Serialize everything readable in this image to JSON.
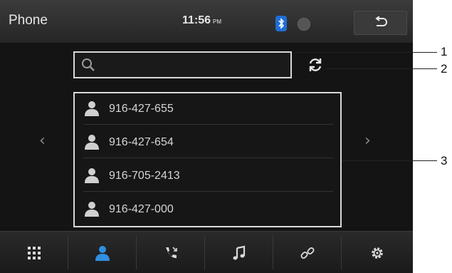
{
  "header": {
    "title": "Phone",
    "time": "11:56",
    "ampm": "PM",
    "bluetooth_icon": "bluetooth-icon",
    "status_icon": "status-circle-icon",
    "back_icon": "back-arrow-icon"
  },
  "search": {
    "placeholder": "",
    "value": "",
    "search_icon": "search-icon",
    "sync_icon": "sync-icon"
  },
  "contacts": [
    {
      "number": "916-427-655"
    },
    {
      "number": "916-427-654"
    },
    {
      "number": "916-705-2413"
    },
    {
      "number": "916-427-000"
    }
  ],
  "pager": {
    "prev": "‹",
    "next": "›"
  },
  "bottom_nav": [
    {
      "icon": "keypad-icon",
      "active": false
    },
    {
      "icon": "contacts-icon",
      "active": true
    },
    {
      "icon": "call-log-icon",
      "active": false
    },
    {
      "icon": "music-icon",
      "active": false
    },
    {
      "icon": "link-icon",
      "active": false
    },
    {
      "icon": "settings-icon",
      "active": false
    }
  ],
  "callouts": [
    "1",
    "2",
    "3"
  ],
  "colors": {
    "accent": "#2f8fe0",
    "bluetooth": "#1e6fd6",
    "background": "#141414"
  }
}
